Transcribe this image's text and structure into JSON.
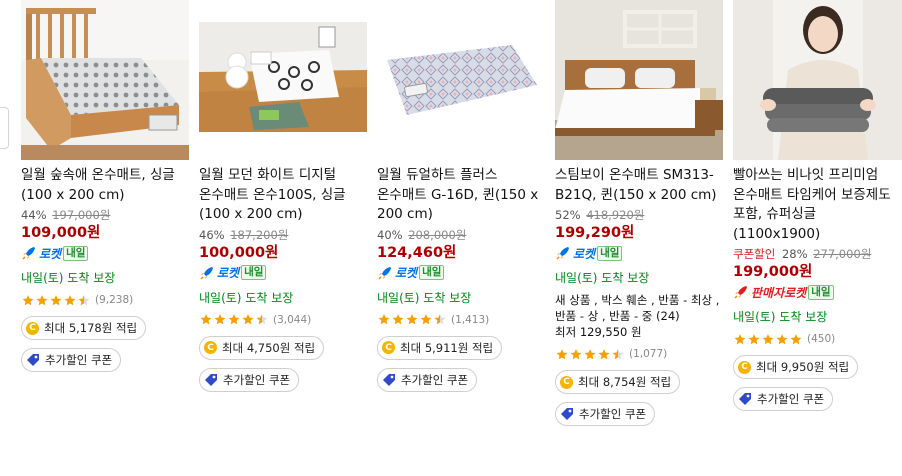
{
  "products": [
    {
      "title": "일월 숲속애 온수매트, 싱글(100 x 200 cm)",
      "discount": "44%",
      "original_price": "197,000원",
      "coupon_label": "",
      "price": "109,000원",
      "rocket_label": "로켓",
      "rocket_type": "rocket",
      "tomorrow_badge": "내일",
      "delivery": "내일(토) 도착 보장",
      "rating": 4.5,
      "review_count": "(9,238)",
      "points": "최대 5,178원 적립",
      "coupon_chip": "추가할인 쿠폰",
      "extra_lines": [],
      "image_desc": "single wooden bed with patterned mattress pad"
    },
    {
      "title": "일월 모던 화이트 디지털 온수매트 온수100S, 싱글(100 x 200 cm)",
      "discount": "46%",
      "original_price": "187,200원",
      "coupon_label": "",
      "price": "100,000원",
      "rocket_label": "로켓",
      "rocket_type": "rocket",
      "tomorrow_badge": "내일",
      "delivery": "내일(토) 도착 보장",
      "rating": 4.5,
      "review_count": "(3,044)",
      "points": "최대 4,750원 적립",
      "coupon_chip": "추가할인 쿠폰",
      "extra_lines": [],
      "image_desc": "white mattress pad on floor with teddy bear"
    },
    {
      "title": "일월 듀얼하트 플러스 온수매트 G-16D, 퀸(150 x 200 cm)",
      "discount": "40%",
      "original_price": "208,000원",
      "coupon_label": "",
      "price": "124,460원",
      "rocket_label": "로켓",
      "rocket_type": "rocket",
      "tomorrow_badge": "내일",
      "delivery": "내일(토) 도착 보장",
      "rating": 4.5,
      "review_count": "(1,413)",
      "points": "최대 5,911원 적립",
      "coupon_chip": "추가할인 쿠폰",
      "extra_lines": [],
      "image_desc": "patterned pink and blue mattress pad with controller"
    },
    {
      "title": "스팀보이 온수매트 SM313-B21Q, 퀸(150 x 200 cm)",
      "discount": "52%",
      "original_price": "418,920원",
      "coupon_label": "",
      "price": "199,290원",
      "rocket_label": "로켓",
      "rocket_type": "rocket",
      "tomorrow_badge": "내일",
      "delivery": "내일(토) 도착 보장",
      "rating": 4.5,
      "review_count": "(1,077)",
      "points": "최대 8,754원 적립",
      "coupon_chip": "추가할인 쿠폰",
      "extra_lines": [
        "새 상품 , 박스 훼손 , 반품 - 최상 , 반품 - 상 , 반품 - 중 (24)",
        "최저 129,550 원"
      ],
      "image_desc": "white bed in bedroom with window frame on wall"
    },
    {
      "title": "빨아쓰는 비나잇 프리미엄 온수매트 타임케어 보증제도 포함, 슈퍼싱글(1100x1900)",
      "discount": "28%",
      "original_price": "277,000원",
      "coupon_label": "쿠폰할인",
      "price": "199,000원",
      "rocket_label": "판매자로켓",
      "rocket_type": "seller",
      "tomorrow_badge": "내일",
      "delivery": "내일(토) 도착 보장",
      "rating": 5,
      "review_count": "(450)",
      "points": "최대 9,950원 적립",
      "coupon_chip": "추가할인 쿠폰",
      "extra_lines": [],
      "image_desc": "woman holding folded gray mattress pad"
    }
  ],
  "colors": {
    "price": "#ae0000",
    "rocket": "#0073e9",
    "delivery": "#00891a",
    "star": "#f5a000"
  },
  "icons": {
    "points": "coin-icon",
    "coupon": "coupon-tag-icon",
    "rocket": "rocket-icon",
    "star": "star-icon"
  }
}
